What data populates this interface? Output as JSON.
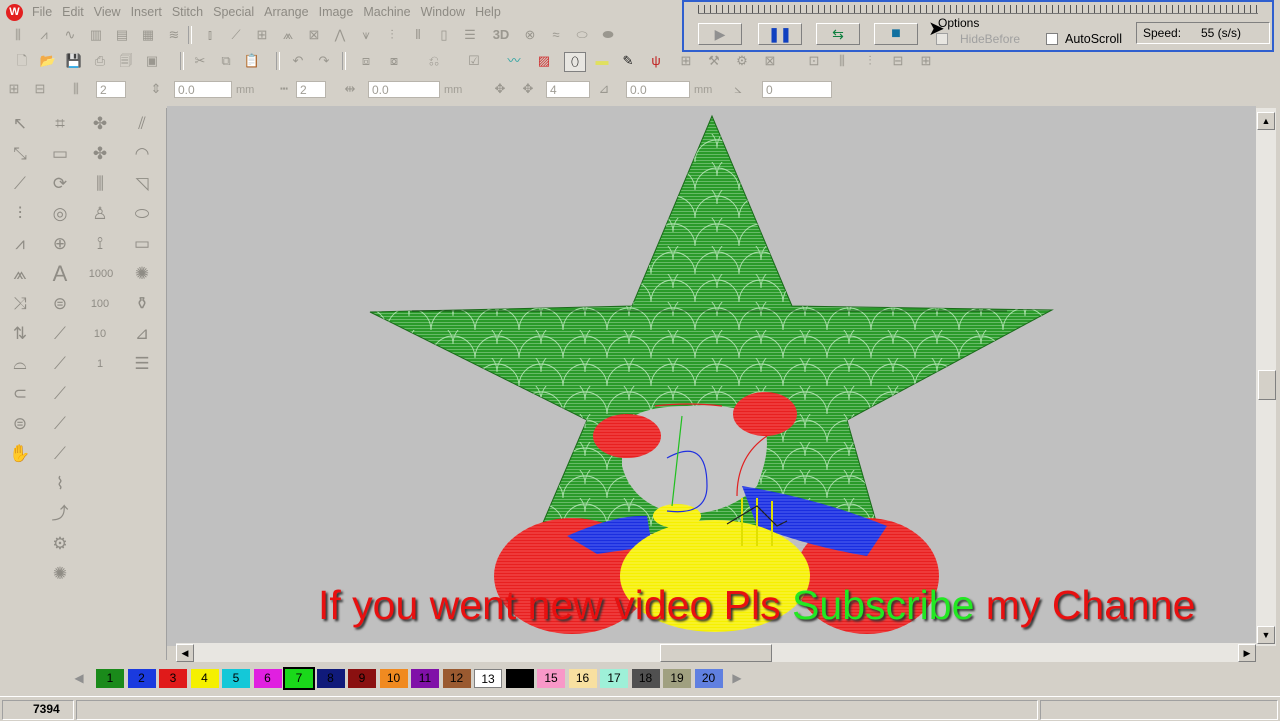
{
  "menu": [
    "File",
    "Edit",
    "View",
    "Insert",
    "Stitch",
    "Special",
    "Arrange",
    "Image",
    "Machine",
    "Window",
    "Help"
  ],
  "toolbar1_text": {
    "three_d": "3D"
  },
  "spinners": {
    "row1": [
      {
        "value": "2",
        "unit": ""
      },
      {
        "value": "0.0",
        "unit": "mm"
      },
      {
        "value": "2",
        "unit": ""
      },
      {
        "value": "0.0",
        "unit": "mm"
      },
      {
        "value": "4",
        "unit": ""
      },
      {
        "value": "0.0",
        "unit": "mm"
      },
      {
        "value": "0",
        "unit": ""
      }
    ]
  },
  "left_tools_text": {
    "font_a": "A",
    "n1000": "1000",
    "n100": "100",
    "n10": "10",
    "n1": "1"
  },
  "sim": {
    "options_label": "Options",
    "hide_before_label": "HideBefore",
    "autoscroll_label": "AutoScroll",
    "speed_label": "Speed:",
    "speed_value": "55 (s/s)"
  },
  "palette": [
    {
      "num": "1",
      "color": "#1a8a1a"
    },
    {
      "num": "2",
      "color": "#1a3adf"
    },
    {
      "num": "3",
      "color": "#e01a1a"
    },
    {
      "num": "4",
      "color": "#f5f000"
    },
    {
      "num": "5",
      "color": "#14c8d8"
    },
    {
      "num": "6",
      "color": "#e020e0"
    },
    {
      "num": "7",
      "color": "#1ad81a"
    },
    {
      "num": "8",
      "color": "#101a7a"
    },
    {
      "num": "9",
      "color": "#8a1010"
    },
    {
      "num": "10",
      "color": "#f08a20"
    },
    {
      "num": "11",
      "color": "#8010a8"
    },
    {
      "num": "12",
      "color": "#9a5a30"
    },
    {
      "num": "13",
      "color": "#ffffff"
    },
    {
      "num": "14",
      "color": "#000000"
    },
    {
      "num": "15",
      "color": "#f898c8"
    },
    {
      "num": "16",
      "color": "#f8e0a0"
    },
    {
      "num": "17",
      "color": "#9ef0d8"
    },
    {
      "num": "18",
      "color": "#505050"
    },
    {
      "num": "19",
      "color": "#a0a080"
    },
    {
      "num": "20",
      "color": "#6080e0"
    }
  ],
  "status": {
    "stitch_count": "7394"
  },
  "overlay": {
    "part1": "If you went new video Pls",
    "part2": "Subscribe",
    "part3": "my Channe"
  }
}
